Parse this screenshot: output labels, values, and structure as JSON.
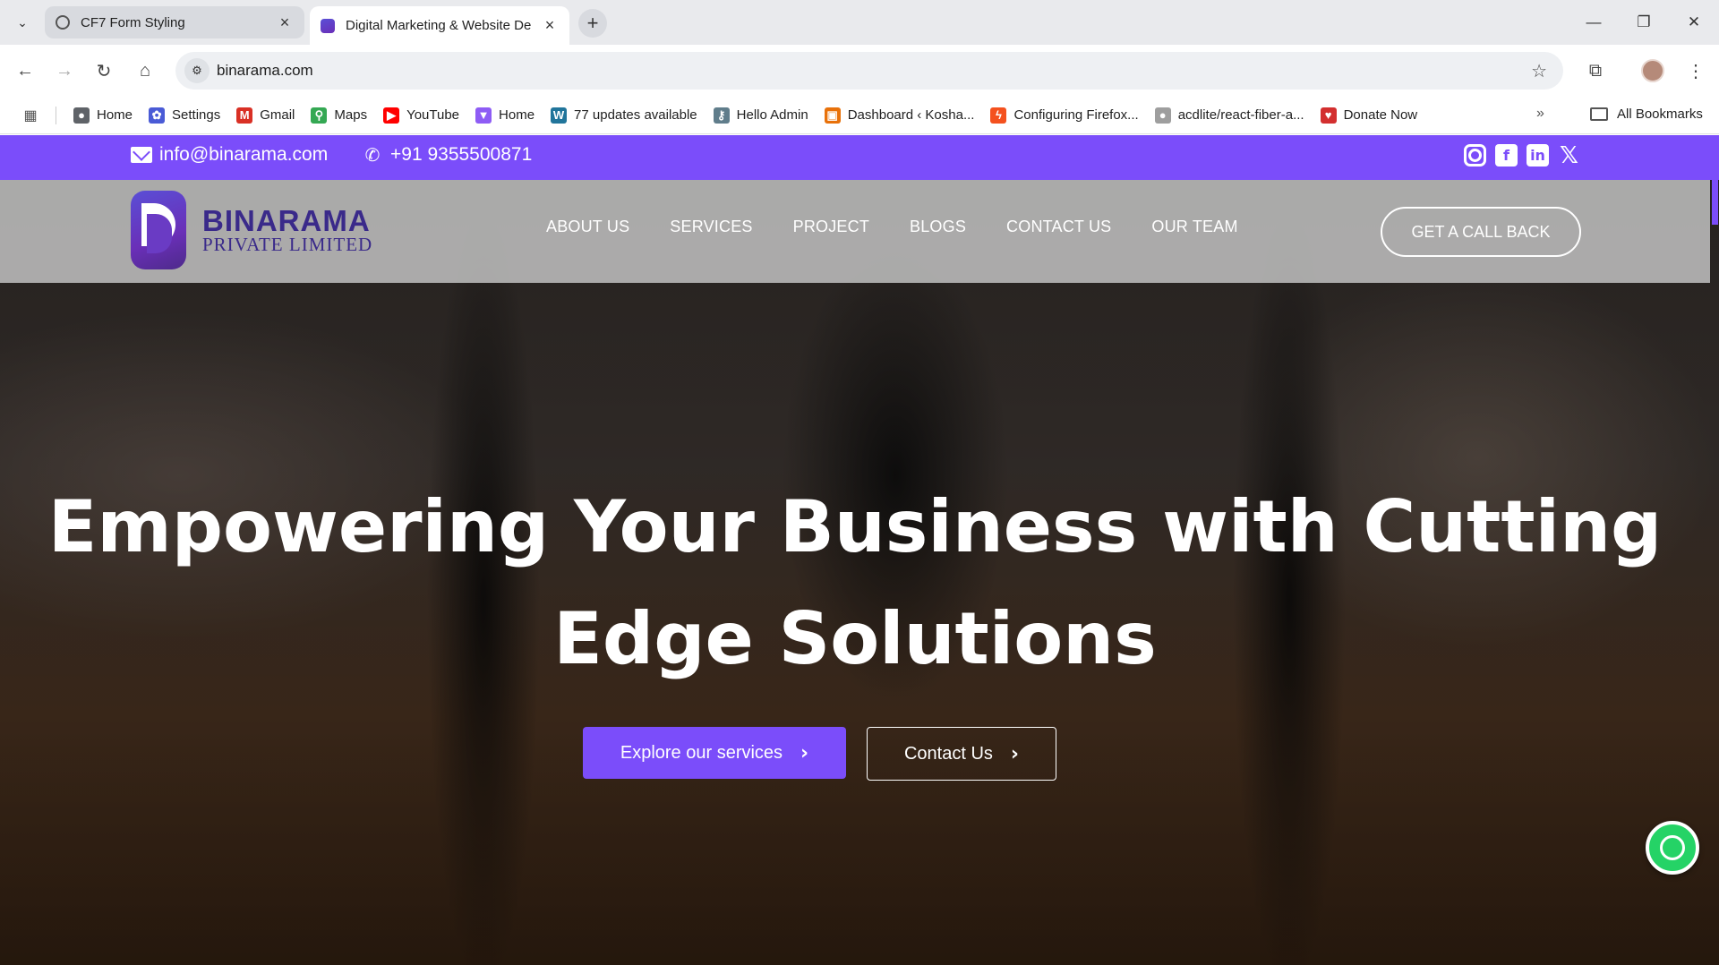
{
  "browser": {
    "tabs": [
      {
        "title": "CF7 Form Styling",
        "active": false
      },
      {
        "title": "Digital Marketing & Website De",
        "active": true
      }
    ],
    "address": "binarama.com",
    "bookmarks": [
      {
        "label": "Home",
        "icon": "chromium-icon",
        "color": "#5f6368"
      },
      {
        "label": "Settings",
        "icon": "gear-icon",
        "color": "#4a5bd6"
      },
      {
        "label": "Gmail",
        "icon": "gmail-icon",
        "color": "#d93025"
      },
      {
        "label": "Maps",
        "icon": "maps-pin-icon",
        "color": "#34a853"
      },
      {
        "label": "YouTube",
        "icon": "youtube-icon",
        "color": "#ff0000"
      },
      {
        "label": "Home",
        "icon": "vite-icon",
        "color": "#8e5cf5"
      },
      {
        "label": "77 updates available",
        "icon": "wordpress-icon",
        "color": "#21759b"
      },
      {
        "label": "Hello Admin",
        "icon": "key-icon",
        "color": "#607d8b"
      },
      {
        "label": "Dashboard ‹ Kosha...",
        "icon": "dashboard-icon",
        "color": "#e8710a"
      },
      {
        "label": "Configuring Firefox...",
        "icon": "bolt-icon",
        "color": "#f4511e"
      },
      {
        "label": "acdlite/react-fiber-a...",
        "icon": "github-icon",
        "color": "#9e9e9e"
      },
      {
        "label": "Donate Now",
        "icon": "donate-icon",
        "color": "#d32f2f"
      }
    ],
    "all_bookmarks": "All Bookmarks"
  },
  "topbar": {
    "email": "info@binarama.com",
    "phone": "+91 9355500871",
    "accent": "#7b4dfa"
  },
  "header": {
    "logo_name": "BINARAMA",
    "logo_sub": "PRIVATE LIMITED",
    "nav": [
      "ABOUT US",
      "SERVICES",
      "PROJECT",
      "BLOGS",
      "CONTACT US",
      "OUR TEAM"
    ],
    "cta": "GET A CALL BACK"
  },
  "hero": {
    "title_line1": "Empowering Your Business with Cutting",
    "title_line2": "Edge Solutions",
    "primary_button": "Explore our services",
    "secondary_button": "Contact Us"
  }
}
